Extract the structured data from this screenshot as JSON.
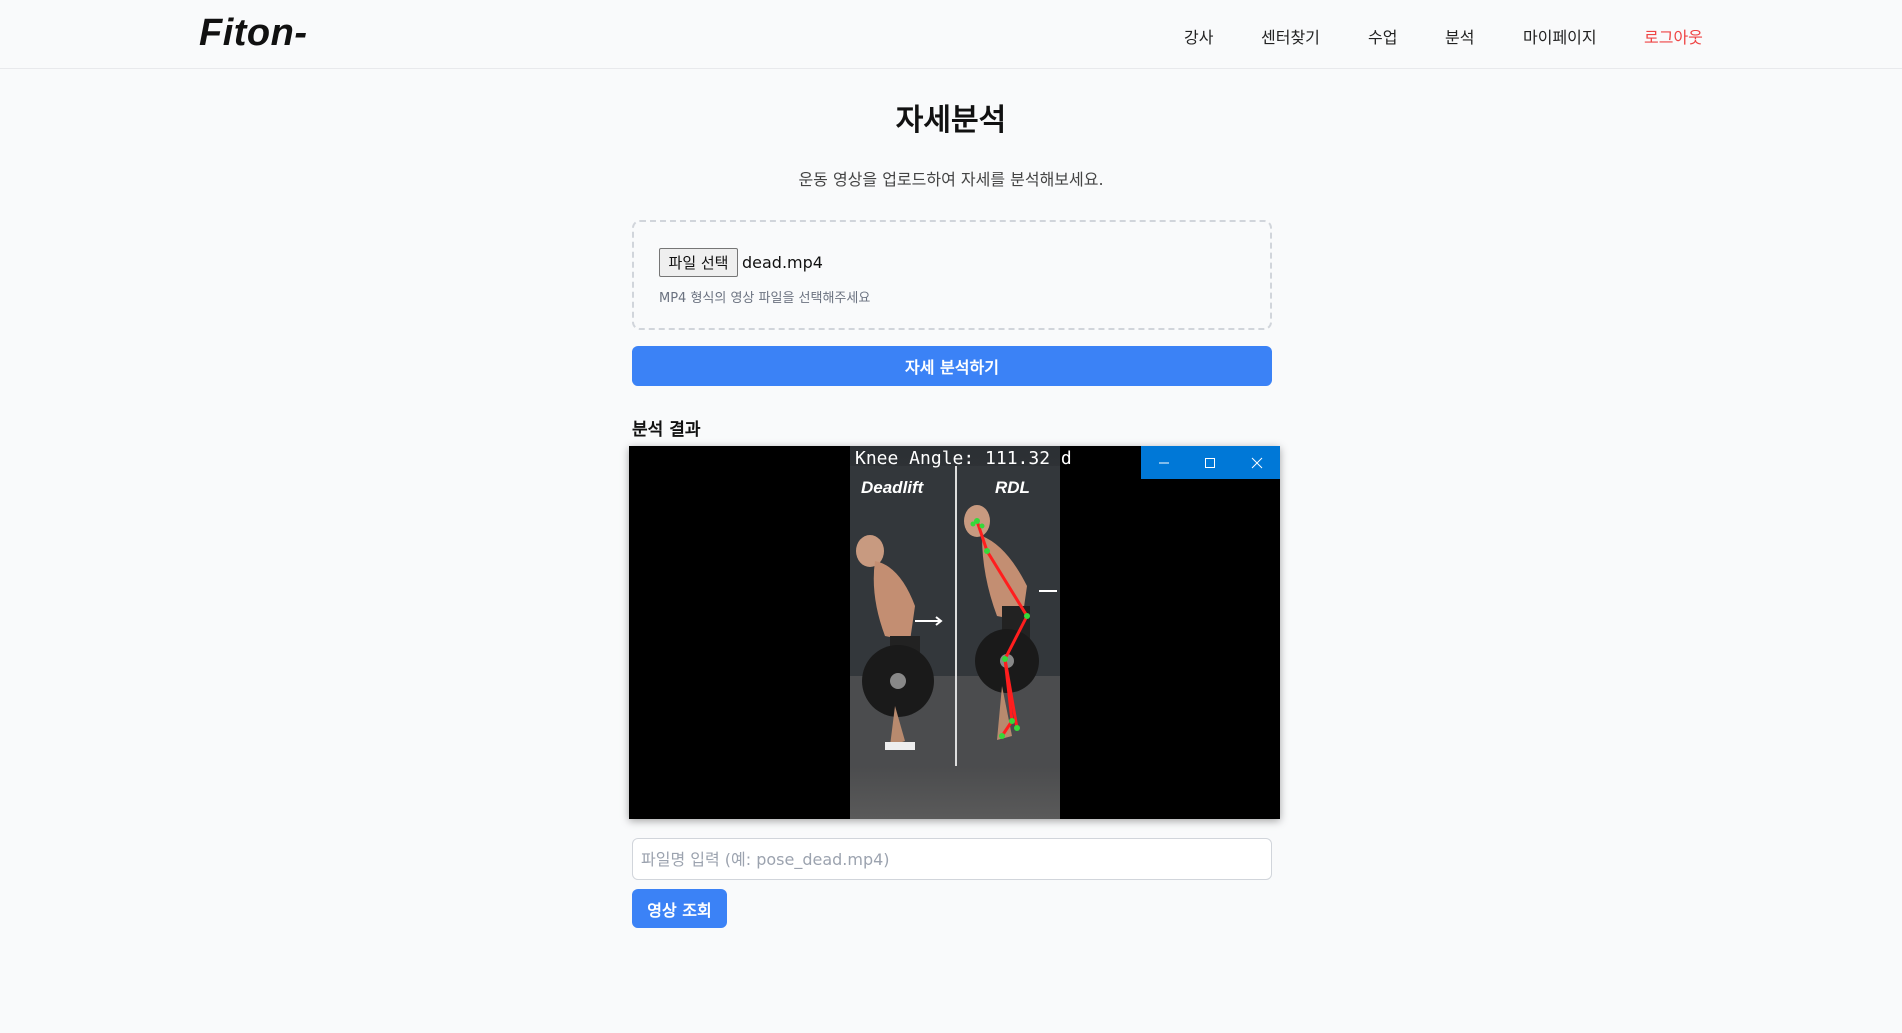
{
  "header": {
    "logo": "Fiton-",
    "nav": [
      "강사",
      "센터찾기",
      "수업",
      "분석",
      "마이페이지"
    ],
    "logout": "로그아웃"
  },
  "page": {
    "title": "자세분석",
    "subtitle": "운동 영상을 업로드하여 자세를 분석해보세요."
  },
  "upload": {
    "button_label": "파일 선택",
    "file_name": "dead.mp4",
    "hint": "MP4 형식의 영상 파일을 선택해주세요"
  },
  "analyze_button": "자세 분석하기",
  "result": {
    "title": "분석 결과",
    "overlay_text": "Knee Angle: 111.32 d",
    "left_label": "Deadlift",
    "right_label": "RDL",
    "window_controls": [
      "minimize-icon",
      "maximize-icon",
      "close-icon"
    ]
  },
  "lookup": {
    "placeholder": "파일명 입력 (예: pose_dead.mp4)",
    "value": "",
    "button_label": "영상 조회"
  },
  "colors": {
    "primary": "#3b82f6",
    "logout": "#ef4444",
    "window_titlebar": "#0078d7"
  }
}
